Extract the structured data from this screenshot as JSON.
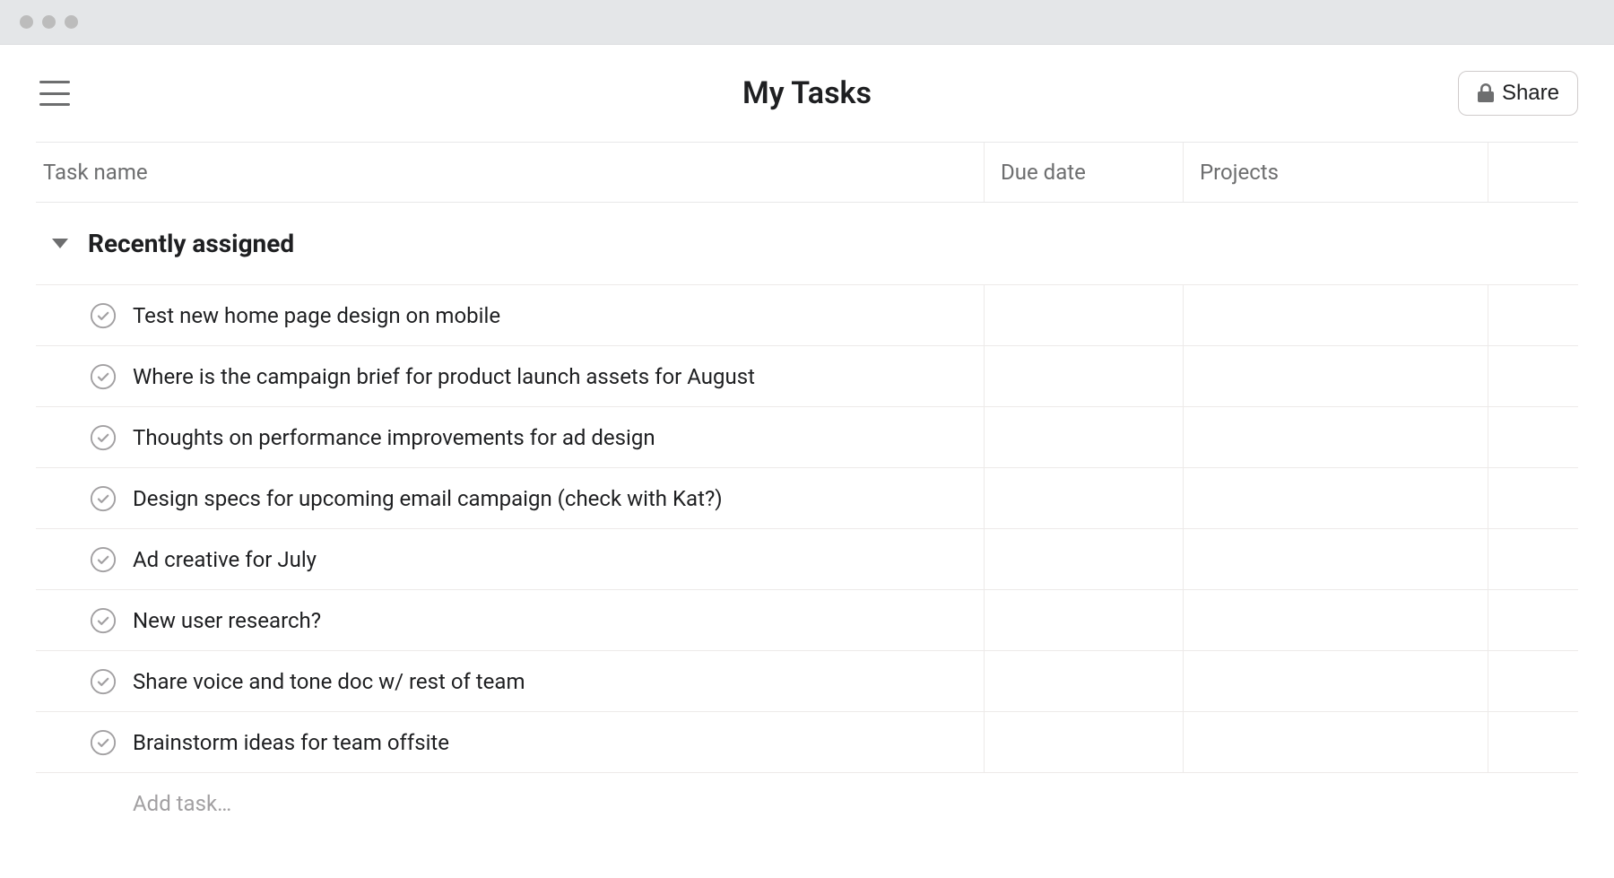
{
  "header": {
    "title": "My Tasks",
    "share_label": "Share"
  },
  "columns": {
    "name": "Task name",
    "due": "Due date",
    "projects": "Projects"
  },
  "section": {
    "title": "Recently assigned"
  },
  "tasks": [
    {
      "name": "Test new home page design on mobile"
    },
    {
      "name": "Where is the campaign brief for product launch assets for August"
    },
    {
      "name": "Thoughts on performance improvements for ad design"
    },
    {
      "name": "Design specs for upcoming email campaign (check with Kat?)"
    },
    {
      "name": "Ad creative for July"
    },
    {
      "name": "New user research?"
    },
    {
      "name": "Share voice and tone doc w/ rest of team"
    },
    {
      "name": "Brainstorm ideas for team offsite"
    }
  ],
  "add_task_placeholder": "Add task…"
}
